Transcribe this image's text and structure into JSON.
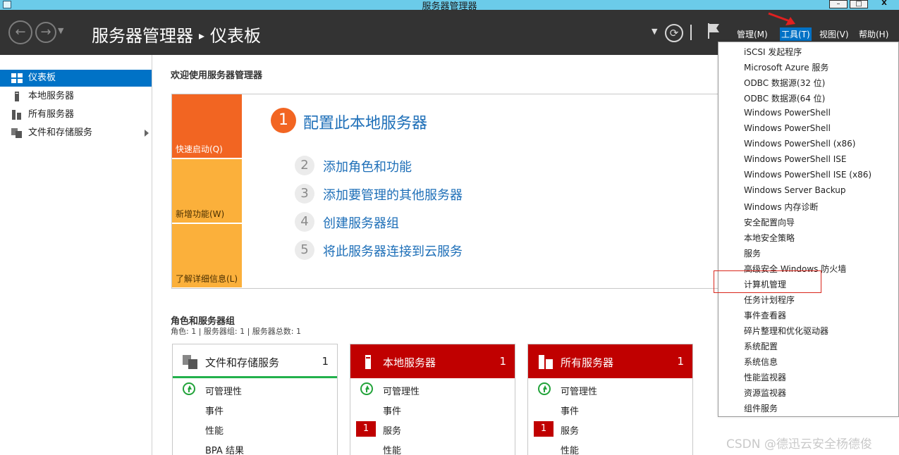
{
  "window": {
    "title": "服务器管理器",
    "min": "–",
    "max": "□",
    "close": "X"
  },
  "header": {
    "breadcrumb_app": "服务器管理器",
    "breadcrumb_sep": "▸",
    "breadcrumb_page": "仪表板",
    "menus": [
      "管理(M)",
      "工具(T)",
      "视图(V)",
      "帮助(H)"
    ]
  },
  "sidebar": {
    "items": [
      {
        "label": "仪表板"
      },
      {
        "label": "本地服务器"
      },
      {
        "label": "所有服务器"
      },
      {
        "label": "文件和存储服务"
      }
    ]
  },
  "welcome": {
    "title": "欢迎使用服务器管理器",
    "tiles": [
      "快速启动(Q)",
      "新增功能(W)",
      "了解详细信息(L)"
    ],
    "steps": [
      {
        "num": "1",
        "label": "配置此本地服务器"
      },
      {
        "num": "2",
        "label": "添加角色和功能"
      },
      {
        "num": "3",
        "label": "添加要管理的其他服务器"
      },
      {
        "num": "4",
        "label": "创建服务器组"
      },
      {
        "num": "5",
        "label": "将此服务器连接到云服务"
      }
    ]
  },
  "roles": {
    "title": "角色和服务器组",
    "subtitle": "角色: 1 | 服务器组: 1 | 服务器总数: 1",
    "cards": [
      {
        "name": "文件和存储服务",
        "count": "1",
        "rows": [
          "可管理性",
          "事件",
          "性能",
          "BPA 结果"
        ],
        "badge": ""
      },
      {
        "name": "本地服务器",
        "count": "1",
        "rows": [
          "可管理性",
          "事件",
          "服务",
          "性能"
        ],
        "badge": "1"
      },
      {
        "name": "所有服务器",
        "count": "1",
        "rows": [
          "可管理性",
          "事件",
          "服务",
          "性能"
        ],
        "badge": "1"
      }
    ]
  },
  "tools_menu": [
    "iSCSI 发起程序",
    "Microsoft Azure 服务",
    "ODBC 数据源(32 位)",
    "ODBC 数据源(64 位)",
    "Windows PowerShell",
    "Windows PowerShell",
    "Windows PowerShell (x86)",
    "Windows PowerShell ISE",
    "Windows PowerShell ISE (x86)",
    "Windows Server Backup",
    "Windows 内存诊断",
    "安全配置向导",
    "本地安全策略",
    "服务",
    "高级安全 Windows 防火墙",
    "计算机管理",
    "任务计划程序",
    "事件查看器",
    "碎片整理和优化驱动器",
    "系统配置",
    "系统信息",
    "性能监视器",
    "资源监视器",
    "组件服务"
  ],
  "watermark": "CSDN @德迅云安全杨德俊",
  "colors": {
    "accent": "#0072c6",
    "orange": "#f26522",
    "amber": "#fbb03b",
    "alert": "#c00000",
    "ok": "#22b14c",
    "header": "#333333"
  }
}
